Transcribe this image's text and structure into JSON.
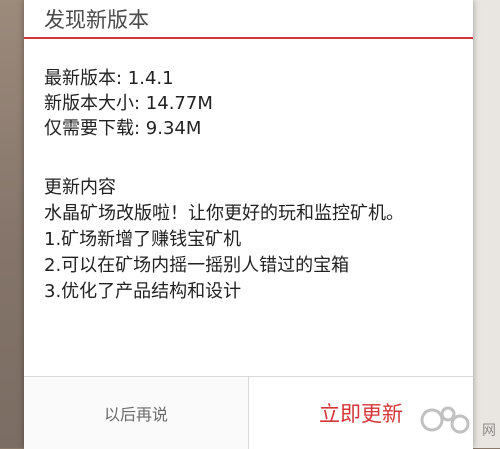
{
  "dialog": {
    "title": "发现新版本",
    "info": [
      "最新版本: 1.4.1",
      "新版本大小: 14.77M",
      "仅需要下载: 9.34M"
    ],
    "notes": [
      "更新内容",
      "水晶矿场改版啦！让你更好的玩和监控矿机。",
      "1.矿场新增了赚钱宝矿机",
      "2.可以在矿场内摇一摇别人错过的宝箱",
      "3.优化了产品结构和设计"
    ],
    "buttons": {
      "later": "以后再说",
      "update_now": "立即更新"
    }
  },
  "watermark": {
    "char": "网"
  },
  "colors": {
    "accent": "#d5363a",
    "title_text": "#4a4a4a",
    "body_text": "#222222",
    "secondary_button_text": "#6b6b6b"
  }
}
